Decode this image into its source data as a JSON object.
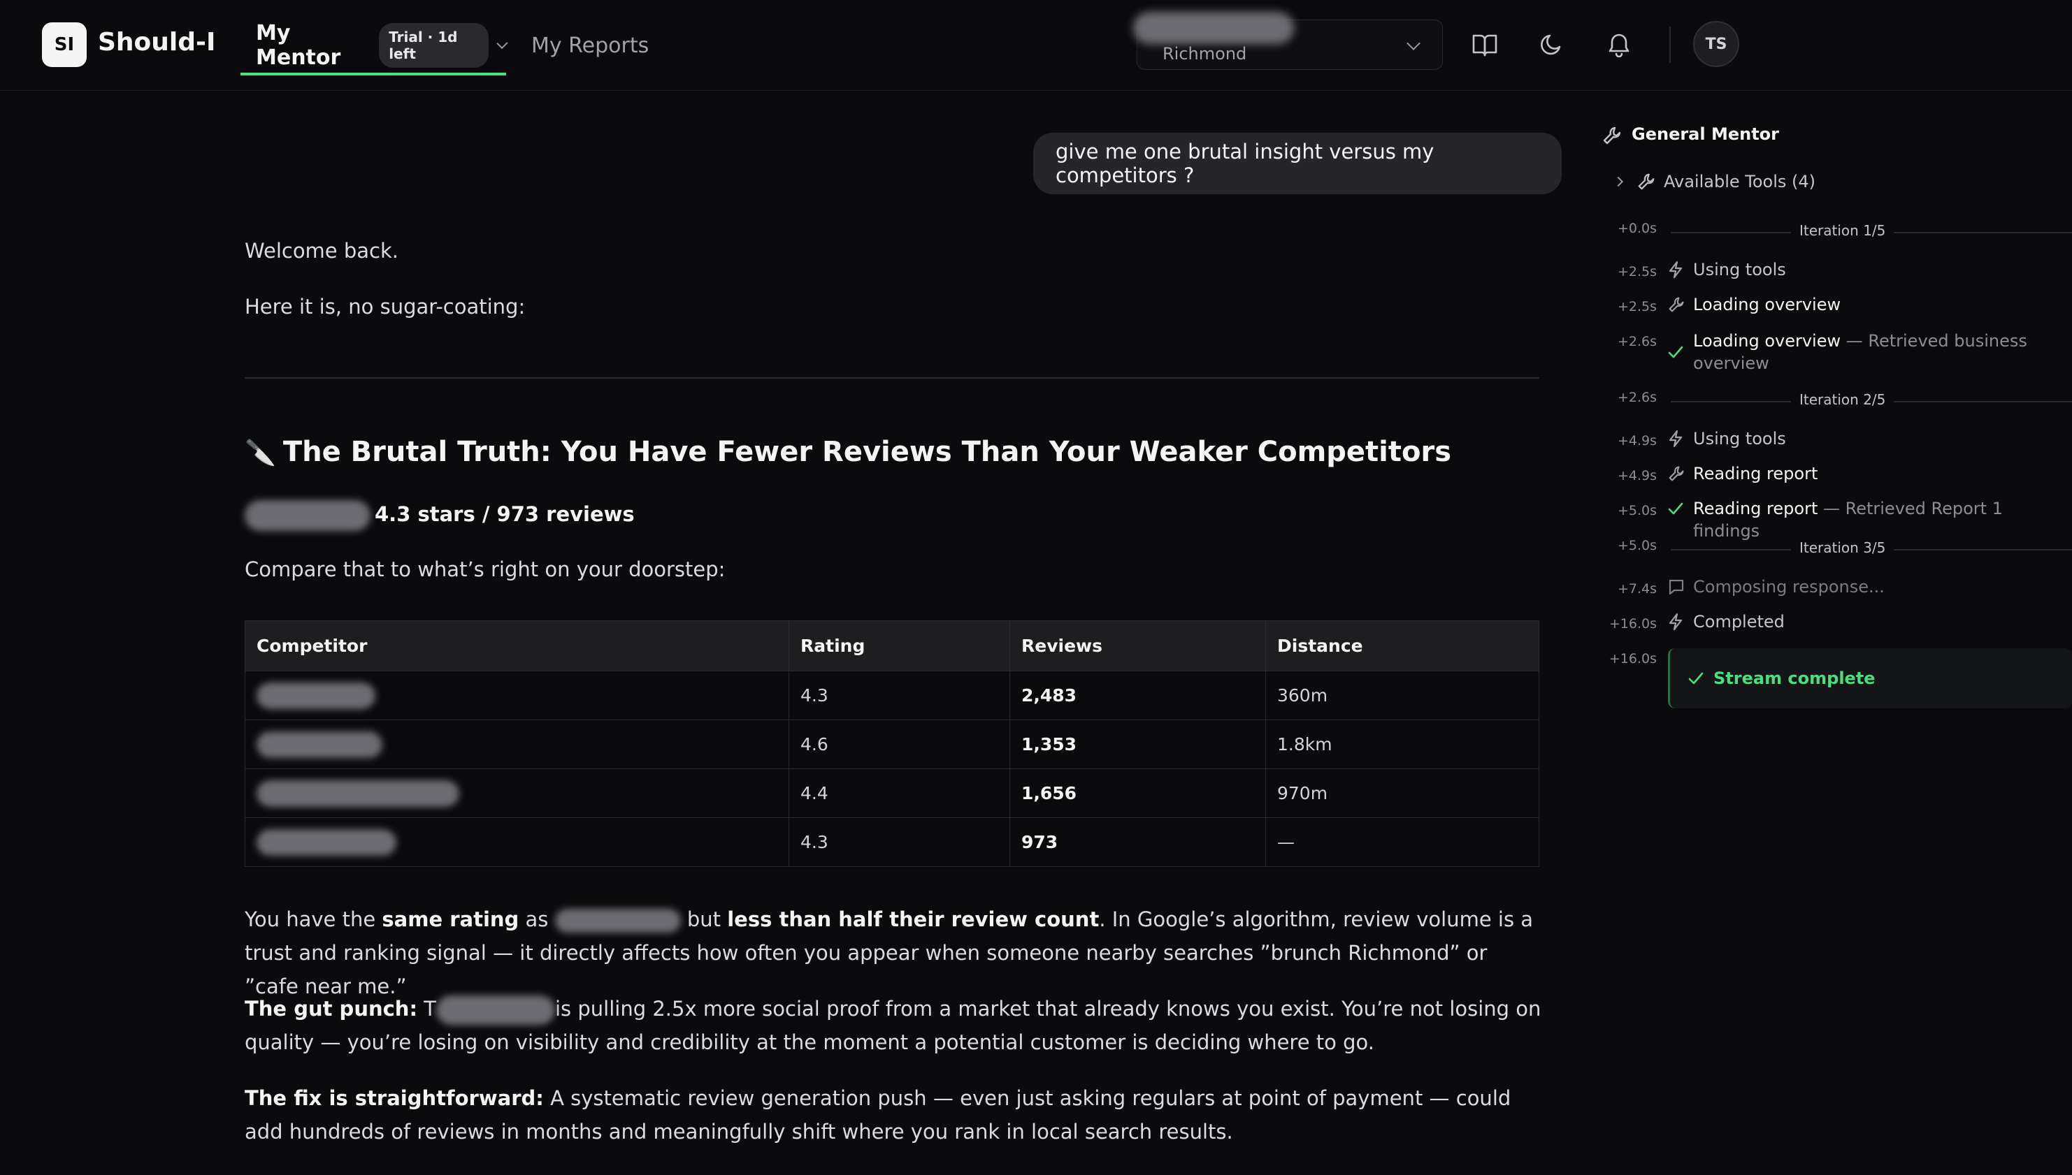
{
  "header": {
    "logo_text": "SI",
    "brand": "Should-I",
    "tabs": [
      {
        "label": "My Mentor",
        "badge": "Trial · 1d left",
        "active": true
      },
      {
        "label": "My Reports",
        "active": false
      }
    ],
    "location": {
      "value": "Richmond"
    },
    "icons": [
      "book-icon",
      "moon-icon",
      "bell-icon"
    ],
    "avatar_initials": "TS"
  },
  "chat": {
    "user_message": "give me one brutal insight versus my competitors ?",
    "greeting": "Welcome back.",
    "intro": "Here it is, no sugar-coating:",
    "heading": "The Brutal Truth: You Have Fewer Reviews Than Your Weaker Competitors",
    "stats": "4.3 stars / 973 reviews",
    "compare": "Compare that to what’s right on your doorstep:",
    "table": {
      "headers": [
        "Competitor",
        "Rating",
        "Reviews",
        "Distance"
      ],
      "rows": [
        {
          "rating": "4.3",
          "reviews": "2,483",
          "distance": "360m"
        },
        {
          "rating": "4.6",
          "reviews": "1,353",
          "distance": "1.8km"
        },
        {
          "rating": "4.4",
          "reviews": "1,656",
          "distance": "970m"
        },
        {
          "rating": "4.3",
          "reviews": "973",
          "distance": "—"
        }
      ]
    },
    "p1": {
      "a": "You have the ",
      "b": "same rating",
      "c": " as ",
      "d": " but ",
      "e": "less than half their review count",
      "f": ". In Google’s algorithm, review volume is a trust and ranking signal — it directly affects how often you appear when someone nearby searches ”brunch Richmond” or ”cafe near me.”"
    },
    "p2": {
      "lead": "The gut punch:",
      "a": " T",
      "b": "is pulling 2.5x more social proof from a market that already knows you exist. You’re not losing on quality — you’re losing on visibility and credibility at the moment a potential customer is deciding where to go."
    },
    "p3": {
      "lead": "The fix is straightforward:",
      "body": " A systematic review generation push — even just asking regulars at point of payment — could add hundreds of reviews in months and meaningfully shift where you rank in local search results."
    }
  },
  "panel": {
    "title": "General Mentor",
    "tools": "Available Tools (4)",
    "timeline": [
      {
        "t": "+0.0s",
        "iter": "Iteration 1/5"
      },
      {
        "t": "+2.5s",
        "label": "Using tools",
        "icon": "bolt-icon"
      },
      {
        "t": "+2.5s",
        "label": "Loading overview",
        "icon": "wrench-icon"
      },
      {
        "t": "+2.6s",
        "label": "Loading overview",
        "detail": " — Retrieved business overview",
        "icon": "check-icon"
      },
      {
        "t": "+2.6s",
        "iter": "Iteration 2/5"
      },
      {
        "t": "+4.9s",
        "label": "Using tools",
        "icon": "bolt-icon"
      },
      {
        "t": "+4.9s",
        "label": "Reading report",
        "icon": "wrench-icon"
      },
      {
        "t": "+5.0s",
        "label": "Reading report",
        "detail": " — Retrieved Report 1 findings",
        "icon": "check-icon"
      },
      {
        "t": "+5.0s",
        "iter": "Iteration 3/5"
      },
      {
        "t": "+7.4s",
        "label": "Composing response...",
        "icon": "message-icon"
      },
      {
        "t": "+16.0s",
        "label": "Completed",
        "icon": "bolt-icon"
      },
      {
        "t": "+16.0s",
        "label": "Stream complete",
        "icon": "check-icon"
      }
    ],
    "colors": {
      "accent": "#4ade80"
    }
  }
}
